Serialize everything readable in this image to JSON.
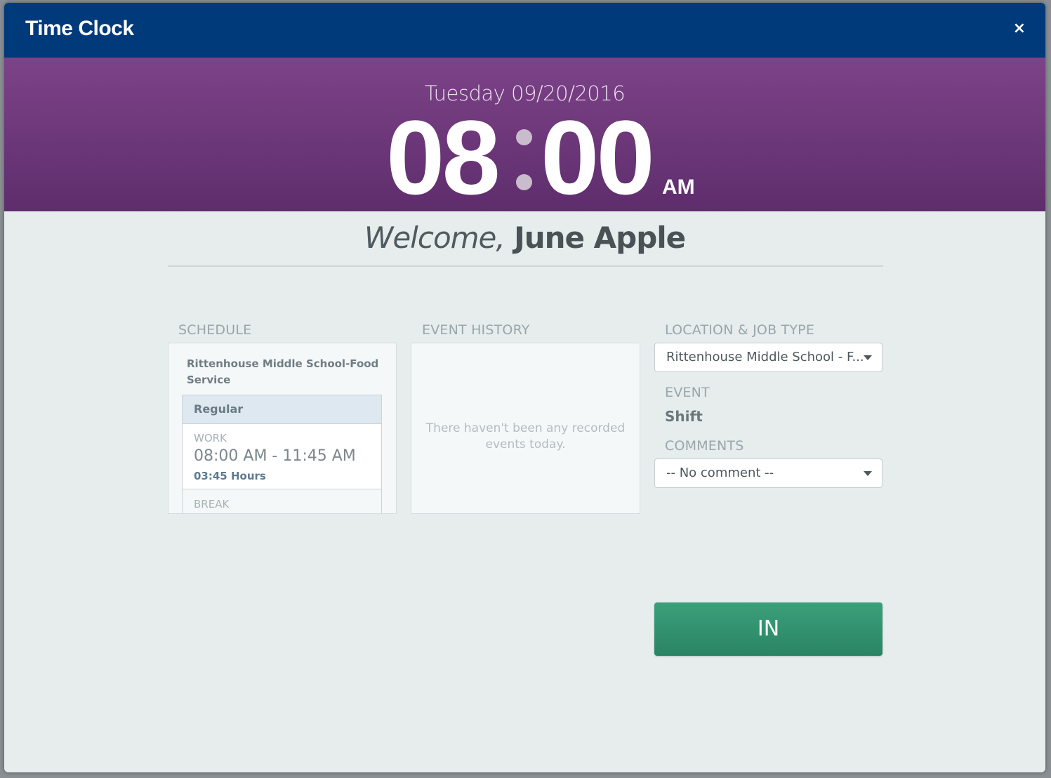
{
  "window": {
    "title": "Time Clock",
    "close_icon": "×"
  },
  "clock": {
    "date": "Tuesday 09/20/2016",
    "hours": "08",
    "minutes": "00",
    "ampm": "AM"
  },
  "welcome": {
    "greeting": "Welcome,",
    "name": "June Apple"
  },
  "schedule": {
    "label": "SCHEDULE",
    "location": "Rittenhouse Middle School-Food Service",
    "type": "Regular",
    "work_label": "WORK",
    "work_time": "08:00 AM - 11:45 AM",
    "work_hours": "03:45 Hours",
    "break_label": "BREAK"
  },
  "event_history": {
    "label": "EVENT HISTORY",
    "empty_message": "There haven't been any recorded events today."
  },
  "location_job": {
    "label": "LOCATION & JOB TYPE",
    "selected": "Rittenhouse Middle School - F..."
  },
  "event": {
    "label": "EVENT",
    "value": "Shift"
  },
  "comments": {
    "label": "COMMENTS",
    "selected": "-- No comment --"
  },
  "actions": {
    "in_label": "IN"
  }
}
